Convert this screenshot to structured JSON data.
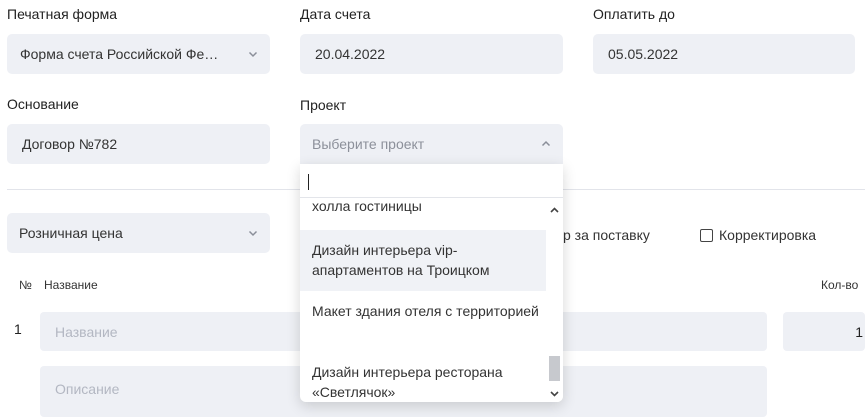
{
  "form": {
    "print_form": {
      "label": "Печатная форма",
      "value": "Форма счета Российской Фе…"
    },
    "invoice_date": {
      "label": "Дата счета",
      "value": "20.04.2022"
    },
    "pay_until": {
      "label": "Оплатить до",
      "value": "05.05.2022"
    },
    "basis": {
      "label": "Основание",
      "value": "Договор №782"
    },
    "project": {
      "label": "Проект",
      "placeholder": "Выберите проект"
    },
    "price_type": {
      "value": "Розничная цена"
    },
    "contract_check": {
      "label": "р за поставку"
    },
    "correction_check": {
      "label": "Корректировка"
    }
  },
  "table": {
    "headers": {
      "num": "№",
      "name": "Название",
      "qty": "Кол-во"
    },
    "rows": [
      {
        "num": "1",
        "name_placeholder": "Название",
        "description_placeholder": "Описание",
        "qty": "1"
      }
    ]
  },
  "project_dropdown": {
    "search_value": "",
    "items": [
      "холла гостиницы",
      "Дизайн интерьера vip-апартаментов на Троицком",
      "Макет здания отеля с территорией",
      "Дизайн интерьера ресторана «Светлячок»"
    ],
    "highlighted_index": 1
  },
  "colors": {
    "field_bg": "#eef0f5",
    "text": "#333333",
    "placeholder": "#b3b7c2"
  }
}
